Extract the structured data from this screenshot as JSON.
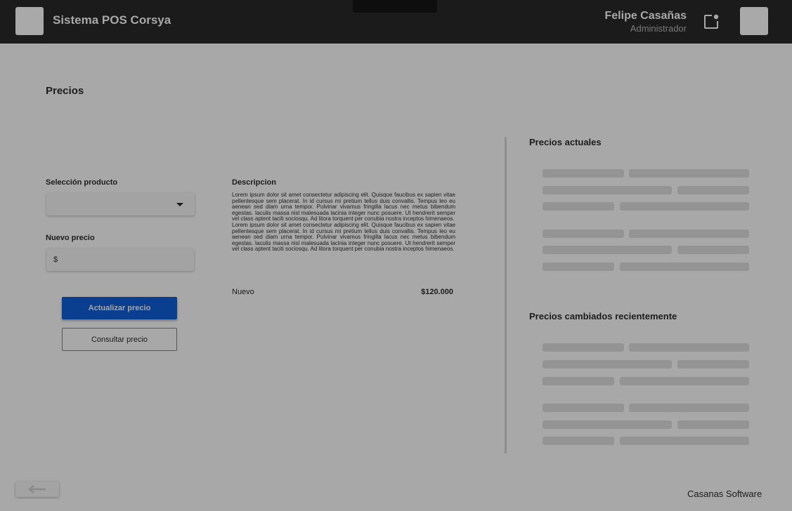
{
  "header": {
    "app_title": "Sistema POS Corsya",
    "user_name": "Felipe Casañas",
    "user_role": "Administrador"
  },
  "main": {
    "page_title": "Precios",
    "product_select_label": "Selección producto",
    "product_select_value": "",
    "new_price_label": "Nuevo precio",
    "new_price_prefix": "$",
    "new_price_value": "",
    "update_button_label": "Actualizar precio",
    "consult_button_label": "Consultar precio"
  },
  "description": {
    "title": "Descripcion",
    "paragraphs": [
      "Lorem ipsum dolor sit amet consectetur adipiscing elit. Quisque faucibus ex sapien vitae pellentesque sem placerat. In id cursus mi pretium tellus duis convallis. Tempus leo eu aenean sed diam urna tempor. Pulvinar vivamus fringilla lacus nec metus bibendum egestas. Iaculis massa nisl malesuada lacinia integer nunc posuere. Ut hendrerit semper vel class aptent taciti sociosqu. Ad litora torquent per conubia nostra inceptos himenaeos.",
      "Lorem ipsum dolor sit amet consectetur adipiscing elit. Quisque faucibus ex sapien vitae pellentesque sem placerat. In id cursus mi pretium tellus duis convallis. Tempus leo eu aenean sed diam urna tempor. Pulvinar vivamus fringilla lacus nec metus bibendum egestas. Iaculis massa nisl malesuada lacinia integer nunc posuere. Ut hendrerit semper vel class aptent taciti sociosqu. Ad litora torquent per conubia nostra inceptos himenaeos."
    ],
    "status": "Nuevo",
    "price": "$120.000"
  },
  "sidebar": {
    "current_prices_title": "Precios actuales",
    "recent_changes_title": "Precios cambiados recientemente"
  },
  "footer": {
    "brand": "Casanas Software"
  },
  "icons": {
    "notification": "notification-icon",
    "back": "arrow-left-icon",
    "dropdown": "chevron-down-icon"
  },
  "colors": {
    "primary_button": "#0a3f8f",
    "topbar": "#1b1b1b",
    "background": "#a8a8a8"
  }
}
